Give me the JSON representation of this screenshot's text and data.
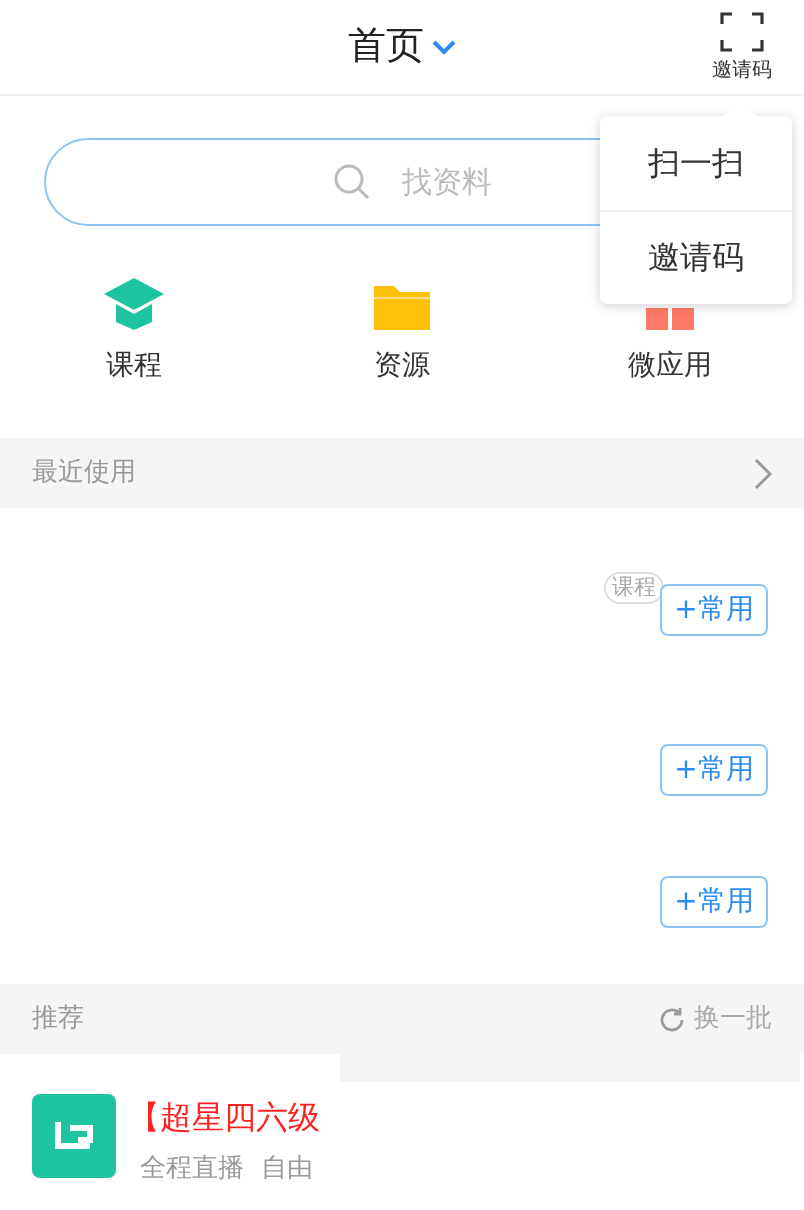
{
  "header": {
    "title": "首页",
    "scan_label": "邀请码"
  },
  "popup_menu": {
    "items": [
      {
        "label": "扫一扫"
      },
      {
        "label": "邀请码"
      }
    ]
  },
  "search": {
    "placeholder": "找资料"
  },
  "shortcuts": [
    {
      "kind": "course",
      "label": "课程"
    },
    {
      "kind": "resource",
      "label": "资源"
    },
    {
      "kind": "apps",
      "label": "微应用"
    }
  ],
  "recent": {
    "title": "最近使用",
    "rows": [
      {
        "tag": "课程",
        "button": "+常用"
      },
      {
        "button": "+常用"
      },
      {
        "button": "+常用"
      }
    ]
  },
  "recommend": {
    "title": "推荐",
    "refresh": "换一批",
    "items": [
      {
        "title": "【超星四六级",
        "subtitle": "全程直播  自由"
      }
    ]
  }
}
